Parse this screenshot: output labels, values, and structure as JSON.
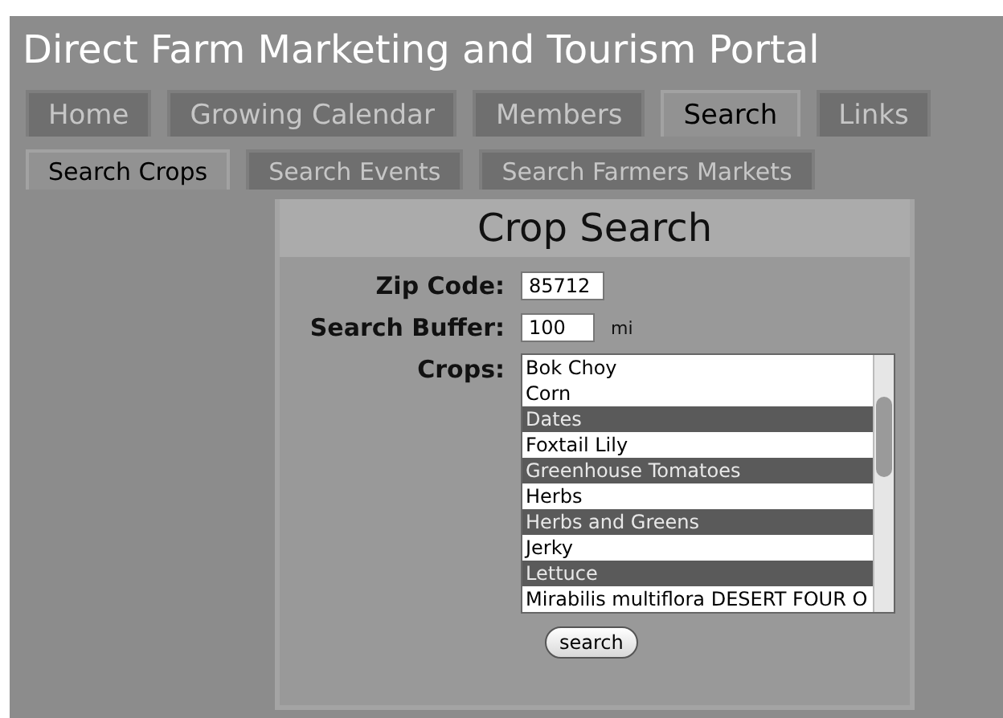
{
  "site_title": "Direct Farm Marketing and Tourism Portal",
  "tabs": [
    {
      "label": "Home",
      "selected": false
    },
    {
      "label": "Growing Calendar",
      "selected": false
    },
    {
      "label": "Members",
      "selected": false
    },
    {
      "label": "Search",
      "selected": true
    },
    {
      "label": "Links",
      "selected": false
    }
  ],
  "subtabs": [
    {
      "label": "Search Crops",
      "selected": true
    },
    {
      "label": "Search Events",
      "selected": false
    },
    {
      "label": "Search Farmers Markets",
      "selected": false
    }
  ],
  "panel": {
    "title": "Crop Search",
    "zip": {
      "label": "Zip Code:",
      "value": "85712"
    },
    "buffer": {
      "label": "Search Buffer:",
      "value": "100",
      "unit": "mi"
    },
    "crops": {
      "label": "Crops:",
      "options": [
        {
          "label": "Bok Choy",
          "selected": false
        },
        {
          "label": "Corn",
          "selected": false
        },
        {
          "label": "Dates",
          "selected": true
        },
        {
          "label": "Foxtail Lily",
          "selected": false
        },
        {
          "label": "Greenhouse Tomatoes",
          "selected": true
        },
        {
          "label": "Herbs",
          "selected": false
        },
        {
          "label": "Herbs and Greens",
          "selected": true
        },
        {
          "label": "Jerky",
          "selected": false
        },
        {
          "label": "Lettuce",
          "selected": true
        },
        {
          "label": "Mirabilis multiflora DESERT FOUR O",
          "selected": false
        }
      ]
    },
    "button": "search"
  }
}
